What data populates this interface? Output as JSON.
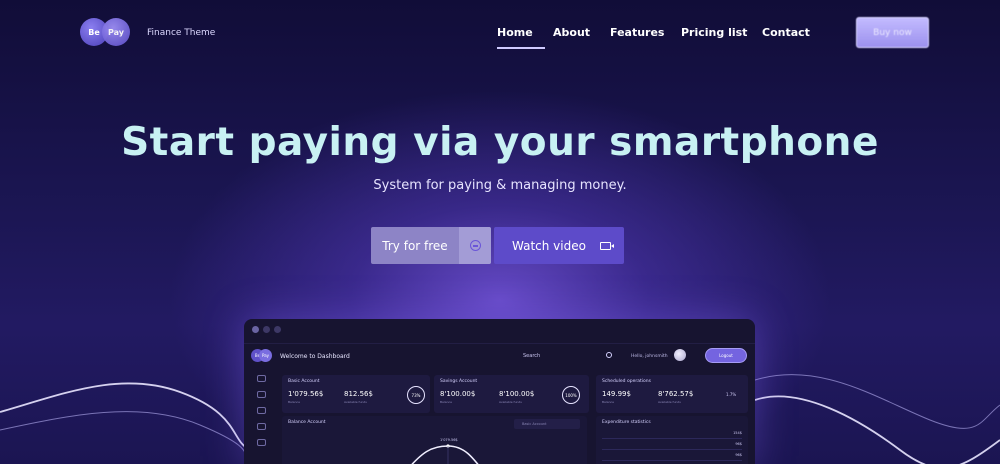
{
  "brand": {
    "logo_left": "Be",
    "logo_right": "Pay",
    "tagline": "Finance Theme"
  },
  "nav": {
    "items": [
      "Home",
      "About",
      "Features",
      "Pricing list",
      "Contact"
    ],
    "active": "Home",
    "cta_label": "Buy now"
  },
  "hero": {
    "title": "Start paying via your smartphone",
    "subtitle": "System for paying & managing money.",
    "primary_button": "Try for free",
    "secondary_button": "Watch video"
  },
  "dashboard": {
    "logo_left": "Be",
    "logo_right": "Pay",
    "welcome": "Welcome to Dashboard",
    "search": "Search",
    "hello": "Hello, johnsmith",
    "logout": "Logout",
    "cards": [
      {
        "title": "Basic Account",
        "value1": "1'079.56$",
        "value2": "812.56$",
        "sub1": "Balance",
        "sub2": "Available funds",
        "ring": "73%"
      },
      {
        "title": "Savings Account",
        "value1": "8'100.00$",
        "value2": "8'100.00$",
        "sub1": "Balance",
        "sub2": "Available funds",
        "ring": "100%"
      },
      {
        "title": "Scheduled operations",
        "value1": "149.99$",
        "value2": "8'762.57$",
        "sub1": "Balance",
        "sub2": "Available funds",
        "ring": "1.7%"
      }
    ],
    "balance_panel": {
      "title": "Balance Account",
      "select": "Basic Account",
      "peak_label": "1'079.56$"
    },
    "expenditure_panel": {
      "title": "Expenditure statistics",
      "values": [
        "154$",
        "96$",
        "96$"
      ]
    }
  },
  "colors": {
    "background": "#14103f",
    "title": "#c8f1f3",
    "accent": "#5d4bc9",
    "button_muted": "#8d84c6"
  }
}
